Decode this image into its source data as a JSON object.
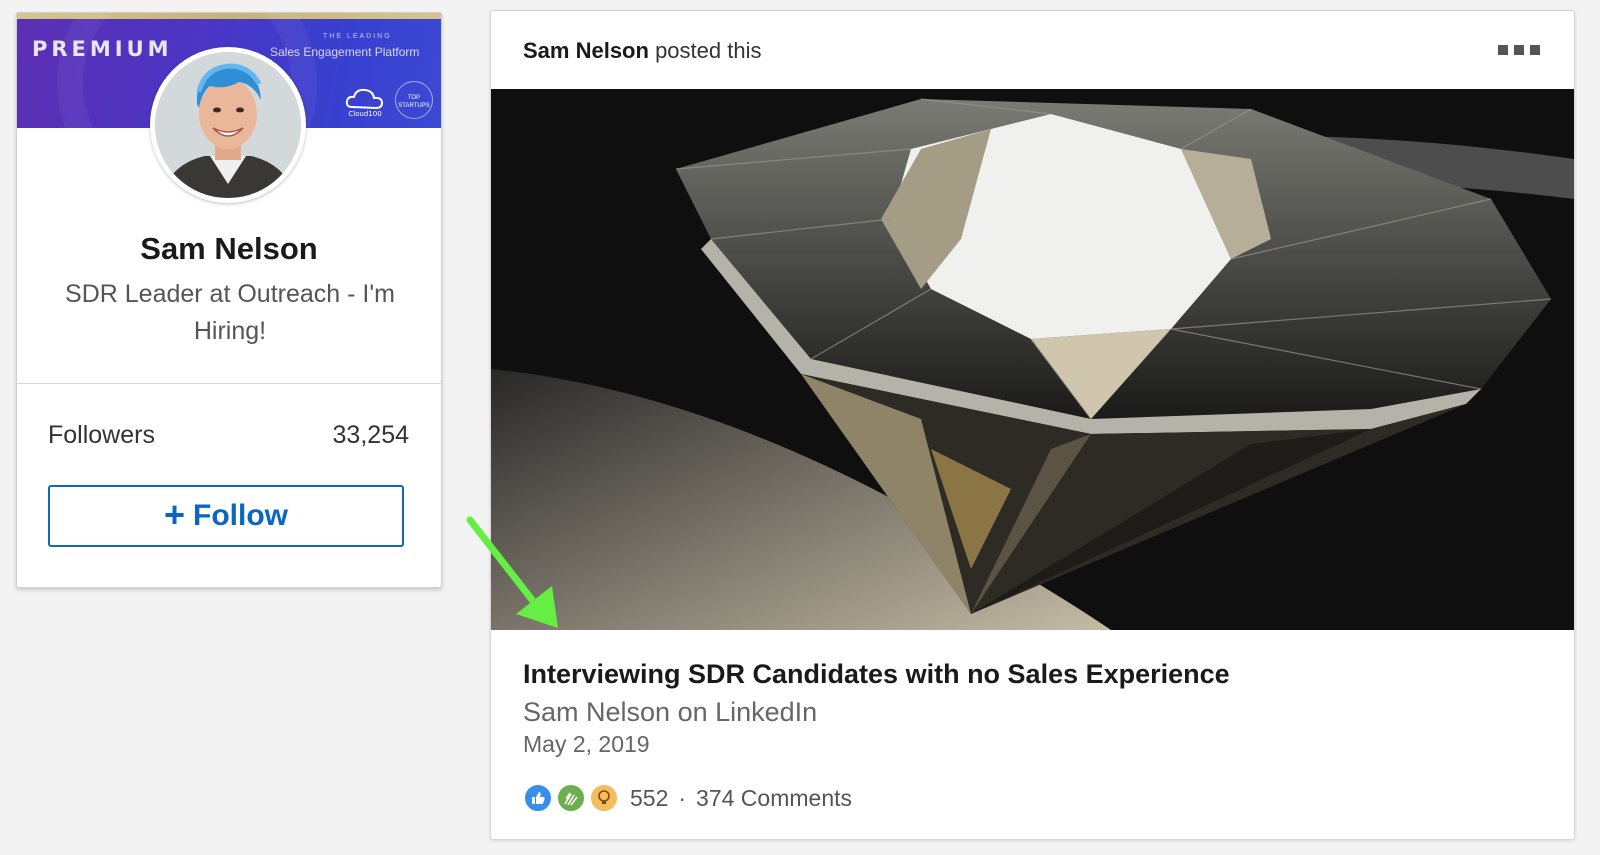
{
  "profile": {
    "banner": {
      "badge": "PREMIUM",
      "leading": "THE LEADING",
      "tagline": "Sales Engagement Platform",
      "cloud_badge": "Cloud100",
      "startups_badge": "TOP STARTUPS"
    },
    "name": "Sam Nelson",
    "headline": "SDR Leader at Outreach - I'm Hiring!",
    "followers_label": "Followers",
    "followers_count": "33,254",
    "follow_label": "Follow"
  },
  "post": {
    "author": "Sam Nelson",
    "action": "posted this",
    "title": "Interviewing SDR Candidates with no Sales Experience",
    "source": "Sam Nelson on LinkedIn",
    "date": "May 2, 2019",
    "reactions": [
      "like-icon",
      "celebrate-icon",
      "insight-icon"
    ],
    "reaction_count": "552",
    "separator": "·",
    "comments": "374 Comments"
  },
  "colors": {
    "accent": "#0a66c2",
    "annotation_arrow": "#66ee44",
    "banner": "#4a36c6"
  }
}
